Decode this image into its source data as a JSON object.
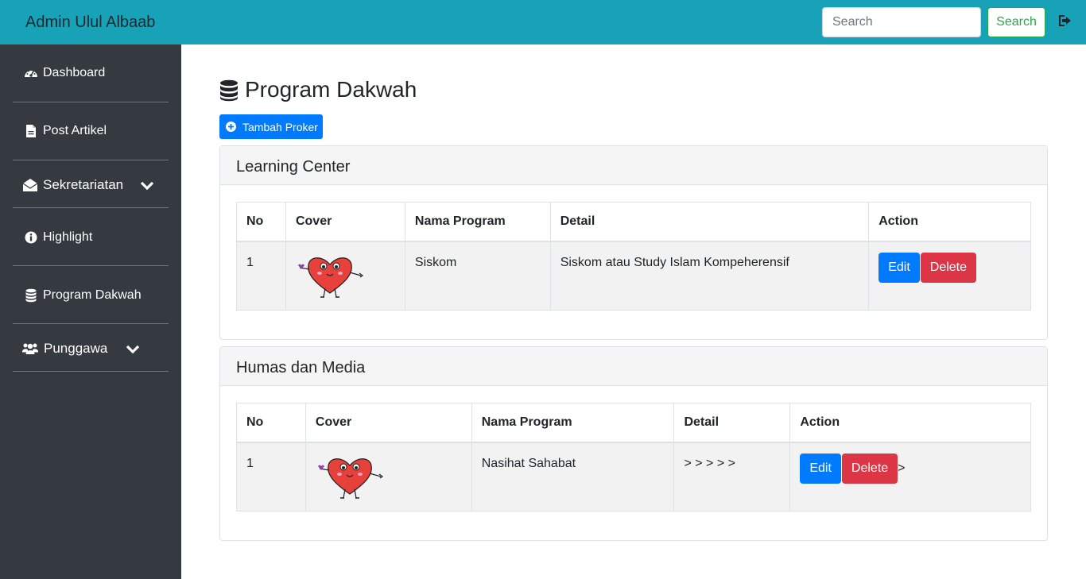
{
  "topbar": {
    "brand": "Admin Ulul Albaab",
    "search_placeholder": "Search",
    "search_button": "Search",
    "logout_icon": "sign-out-icon"
  },
  "sidebar": {
    "items": [
      {
        "label": "Dashboard",
        "icon": "tachometer-icon"
      },
      {
        "label": "Post Artikel",
        "icon": "file-icon"
      },
      {
        "label": "Sekretariatan",
        "icon": "envelope-open-icon",
        "expandable": true
      },
      {
        "label": "Highlight",
        "icon": "info-circle-icon"
      },
      {
        "label": "Program Dakwah",
        "icon": "database-icon"
      },
      {
        "label": "Punggawa",
        "icon": "users-icon",
        "expandable": true
      }
    ]
  },
  "main": {
    "title": "Program Dakwah",
    "add_button": "Tambah Proker",
    "cards": [
      {
        "header": "Learning Center",
        "columns": [
          "No",
          "Cover",
          "Nama Program",
          "Detail",
          "Action"
        ],
        "rows": [
          {
            "no": "1",
            "cover": "heart-mascot-image",
            "nama": "Siskom",
            "detail": "Siskom atau Study Islam Kompeherensif",
            "edit": "Edit",
            "delete": "Delete",
            "trailing": ""
          }
        ]
      },
      {
        "header": "Humas dan Media",
        "columns": [
          "No",
          "Cover",
          "Nama Program",
          "Detail",
          "Action"
        ],
        "rows": [
          {
            "no": "1",
            "cover": "heart-mascot-image",
            "nama": "Nasihat Sahabat",
            "detail": "> > > > >",
            "edit": "Edit",
            "delete": "Delete",
            "trailing": ">"
          }
        ]
      }
    ]
  },
  "colors": {
    "topbar": "#17a2b8",
    "sidebar": "#343a40",
    "primary": "#007bff",
    "danger": "#dc3545",
    "success": "#28a745"
  }
}
